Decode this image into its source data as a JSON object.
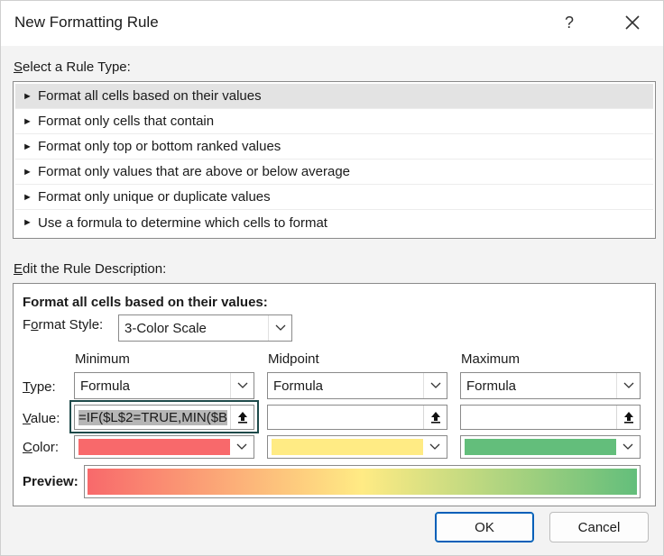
{
  "window": {
    "title": "New Formatting Rule",
    "help_glyph": "?"
  },
  "rule_type": {
    "label_prefix": "",
    "label_hotkey": "S",
    "label_rest": "elect a Rule Type:",
    "items": [
      {
        "label": "Format all cells based on their values",
        "selected": true
      },
      {
        "label": "Format only cells that contain",
        "selected": false
      },
      {
        "label": "Format only top or bottom ranked values",
        "selected": false
      },
      {
        "label": "Format only values that are above or below average",
        "selected": false
      },
      {
        "label": "Format only unique or duplicate values",
        "selected": false
      },
      {
        "label": "Use a formula to determine which cells to format",
        "selected": false
      }
    ],
    "arrow_glyph": "►"
  },
  "description": {
    "label_hotkey": "E",
    "label_rest": "dit the Rule Description:",
    "heading": "Format all cells based on their values:",
    "format_style": {
      "label_pre": "F",
      "label_hotkey": "o",
      "label_rest": "rmat Style:",
      "value": "3-Color Scale"
    },
    "row_labels": {
      "type_hotkey": "T",
      "type_rest": "ype:",
      "value_hotkey": "V",
      "value_rest": "alue:",
      "color_hotkey": "C",
      "color_rest": "olor:"
    },
    "columns": [
      {
        "header": "Minimum",
        "type": "Formula",
        "value": "=IF($L$2=TRUE,MIN($B",
        "color": "#f8696b"
      },
      {
        "header": "Midpoint",
        "type": "Formula",
        "value": "",
        "color": "#ffeb84"
      },
      {
        "header": "Maximum",
        "type": "Formula",
        "value": "",
        "color": "#63be7b"
      }
    ],
    "preview_label": "Preview:"
  },
  "buttons": {
    "ok": "OK",
    "cancel": "Cancel"
  }
}
